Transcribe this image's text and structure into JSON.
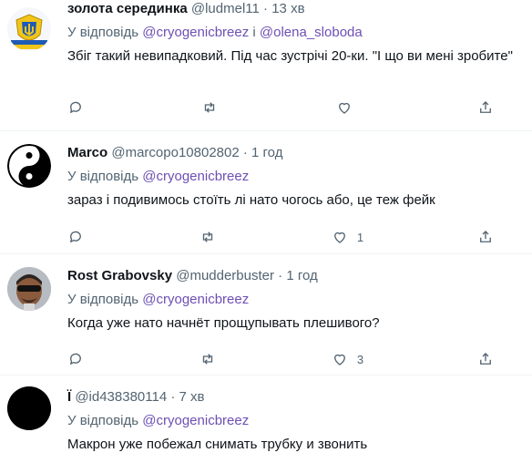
{
  "colors": {
    "link": "#6e4fb4",
    "muted": "#536471",
    "text": "#0f1419"
  },
  "reply_prefix": "У відповідь",
  "and_word": "і",
  "tweets": [
    {
      "name": "золота серединка",
      "handle": "@ludmel11",
      "time": "13 хв",
      "mentions": [
        "@cryogenicbreez",
        "@olena_sloboda"
      ],
      "text": "Збіг такий невипадковий. Під час зустрічі 20-ки. \"І що ви мені зробите\"",
      "likes": "",
      "avatar": "coat-of-arms-icon"
    },
    {
      "name": "Marco",
      "handle": "@marcopo10802802",
      "time": "1 год",
      "mentions": [
        "@cryogenicbreez"
      ],
      "text": "зараз і подивимось стоїть лі нато чогось або, це теж фейк",
      "likes": "1",
      "avatar": "yin-yang-icon"
    },
    {
      "name": "Rost Grabovsky",
      "handle": "@mudderbuster",
      "time": "1 год",
      "mentions": [
        "@cryogenicbreez"
      ],
      "text": "Когда уже нато начнёт прощупывать плешивого?",
      "likes": "3",
      "avatar": "person-photo"
    },
    {
      "name": "Ї",
      "handle": "@id438380114",
      "time": "7 хв",
      "mentions": [
        "@cryogenicbreez"
      ],
      "text": "Макрон уже побежал снимать трубку и звонить",
      "likes": "",
      "avatar": "black-avatar"
    }
  ]
}
